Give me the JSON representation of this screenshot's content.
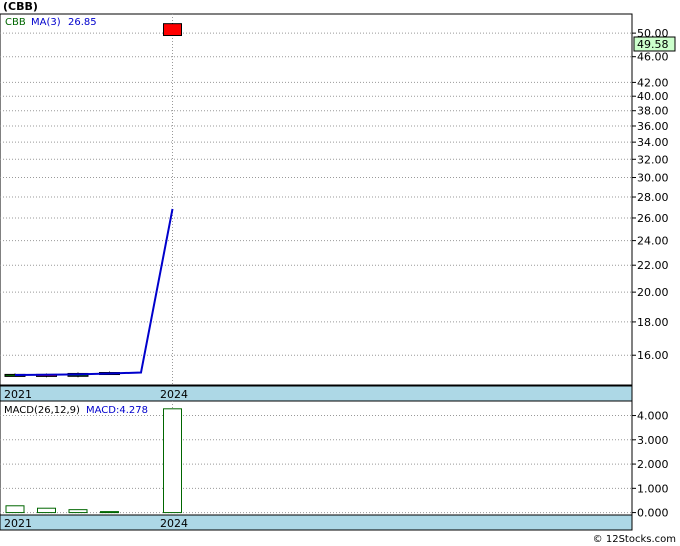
{
  "title": "(CBB)",
  "credit": "© 12Stocks.com",
  "colors": {
    "ma_line": "#0000cc",
    "last_price_bg": "#ccffcc",
    "grid": "#999999",
    "axis_band": "#add8e6",
    "candle_up": "#006600",
    "candle_down": "#ff0000",
    "macd_bar": "#006600"
  },
  "chart_data": [
    {
      "type": "candlestick",
      "panel": "price",
      "legend": {
        "symbol": "CBB",
        "ma_label": "MA(3)",
        "ma_value": "26.85"
      },
      "last_price_label": "49.58",
      "scale": "log",
      "ylim": [
        14.4,
        53.5
      ],
      "y_ticks": [
        "50.00",
        "46.00",
        "42.00",
        "40.00",
        "38.00",
        "36.00",
        "34.00",
        "32.00",
        "30.00",
        "28.00",
        "26.00",
        "24.00",
        "22.00",
        "20.00",
        "18.00",
        "16.00"
      ],
      "x_tick_labels": [
        "2021",
        "2024"
      ],
      "candles": [
        {
          "x": 0,
          "open": 14.9,
          "close": 14.95,
          "high": 15.0,
          "low": 14.85
        },
        {
          "x": 1,
          "open": 14.95,
          "close": 14.85,
          "high": 15.0,
          "low": 14.8
        },
        {
          "x": 2,
          "open": 14.85,
          "close": 15.0,
          "high": 15.05,
          "low": 14.8
        },
        {
          "x": 3,
          "open": 15.0,
          "close": 15.05,
          "high": 15.1,
          "low": 14.95
        },
        {
          "x": 5,
          "open": 49.58,
          "close": 51.7,
          "high": 51.8,
          "low": 49.5
        }
      ],
      "ma": [
        {
          "x": 0,
          "y": 14.92
        },
        {
          "x": 1,
          "y": 14.93
        },
        {
          "x": 2,
          "y": 14.95
        },
        {
          "x": 3,
          "y": 15.0
        },
        {
          "x": 4,
          "y": 15.05
        },
        {
          "x": 5,
          "y": 26.85
        }
      ]
    },
    {
      "type": "bar",
      "panel": "macd",
      "legend": {
        "params": "MACD(26,12,9)",
        "label": "MACD:4.278"
      },
      "ylim": [
        -0.1,
        4.6
      ],
      "y_ticks": [
        "4.000",
        "3.000",
        "2.000",
        "1.000",
        "0.000"
      ],
      "x_tick_labels": [
        "2021",
        "2024"
      ],
      "bars": [
        {
          "x": 0,
          "value": 0.28
        },
        {
          "x": 1,
          "value": 0.18
        },
        {
          "x": 2,
          "value": 0.12
        },
        {
          "x": 3,
          "value": 0.04
        },
        {
          "x": 5,
          "value": 4.278
        }
      ]
    }
  ]
}
